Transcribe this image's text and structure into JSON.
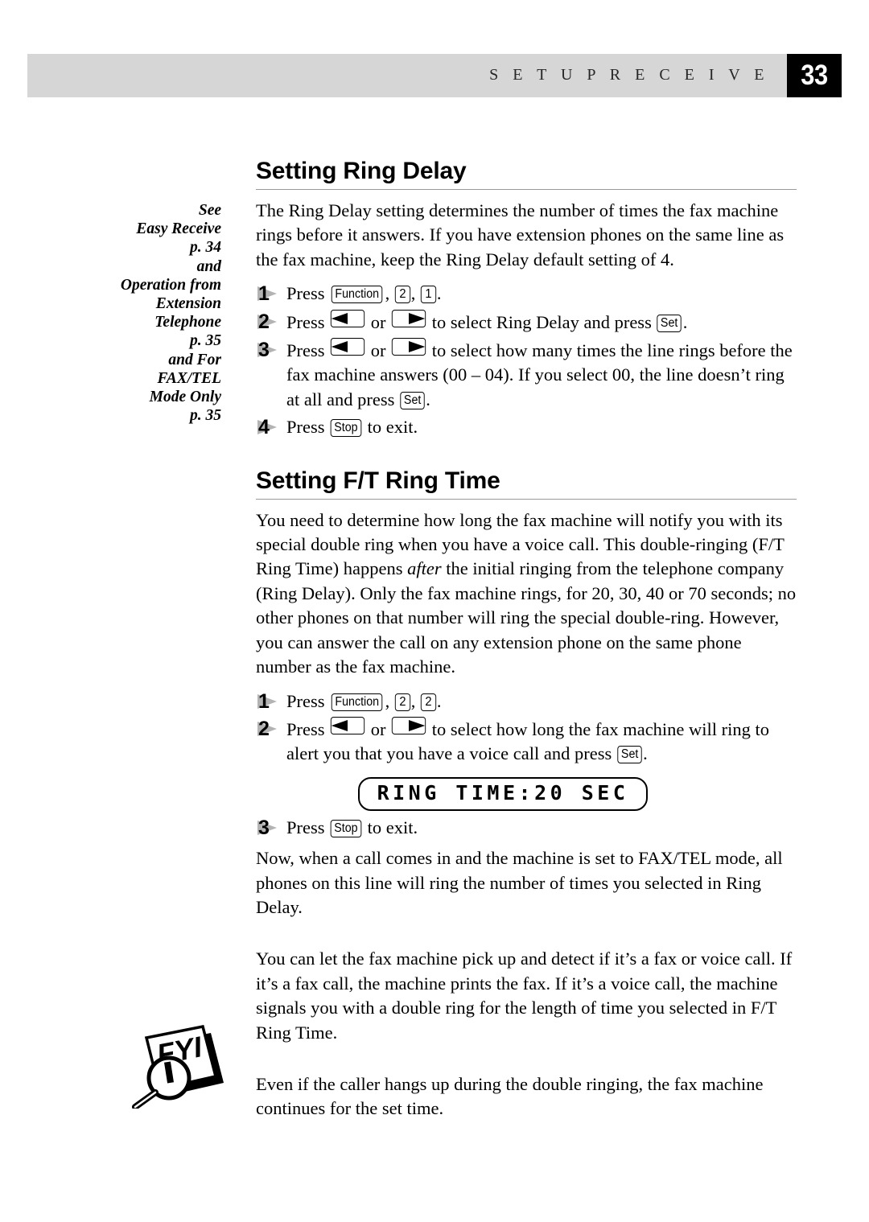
{
  "header": {
    "running_title": "S E T U P   R E C E I V E",
    "page_number": "33",
    "bar_color": "#d6d6d6",
    "page_number_bg": "#000000"
  },
  "margin_note": {
    "lines": [
      "See",
      "Easy Receive",
      "p. 34",
      "and",
      "Operation from",
      "Extension",
      "Telephone",
      "p. 35",
      "and For",
      "FAX/TEL",
      "Mode Only",
      "p. 35"
    ]
  },
  "sections": [
    {
      "heading": "Setting Ring Delay",
      "intro": "The Ring Delay setting determines the number of times the fax machine rings before it answers. If you have extension phones on the same line as the fax machine, keep the Ring Delay default setting of 4.",
      "steps": [
        {
          "num": "1",
          "pre": "Press ",
          "keys_line": "Function, 2, 1."
        },
        {
          "num": "2",
          "pre": "Press ",
          "mid": " or ",
          "post": " to select Ring Delay and press ",
          "tail": "."
        },
        {
          "num": "3",
          "pre": "Press ",
          "mid": " or ",
          "post": " to select how many times the line rings before the fax machine answers (00 – 04). If you select 00, the line doesn’t ring at all and press ",
          "tail": "."
        },
        {
          "num": "4",
          "pre": "Press ",
          "post": " to exit."
        }
      ]
    },
    {
      "heading": "Setting F/T Ring Time",
      "intro_a": "You need to determine how long the fax machine will notify you with its special double ring when you have a voice call. This double-ringing (F/T Ring Time) happens ",
      "intro_italic": "after",
      "intro_b": " the initial ringing from the telephone company (Ring Delay). Only the fax machine rings, for 20, 30, 40 or 70 seconds; no other phones on that number will ring the special double-ring. However, you can answer the call on any extension phone on the same phone number as the fax machine.",
      "steps": [
        {
          "num": "1",
          "pre": "Press ",
          "keys_line": "Function, 2, 2."
        },
        {
          "num": "2",
          "pre": "Press ",
          "mid": " or ",
          "post": " to select how long the fax machine will ring to alert you that you have a voice call and press ",
          "tail": "."
        },
        {
          "num": "3",
          "pre": "Press ",
          "post": " to exit."
        }
      ],
      "lcd_display": "RING TIME:20 SEC",
      "after_text": "Now, when a call comes in and the machine is set to FAX/TEL mode, all phones on this line will ring the number of times you selected in Ring Delay.",
      "detect_text": "You can let the fax machine pick up and detect if it’s a fax or voice call. If it’s a fax call, the machine prints the fax. If it’s a voice call, the machine signals you with a double ring for the length of time you selected in F/T Ring Time.",
      "fyi_text": "Even if the caller hangs up during the double ringing, the fax machine continues for the set time."
    }
  ],
  "keys": {
    "function": "Function",
    "set": "Set",
    "stop": "Stop",
    "digit_1": "1",
    "digit_2": "2",
    "comma": ", ",
    "period": ".",
    "left_arrow": "left-arrow",
    "right_arrow": "right-arrow"
  },
  "icons": {
    "fyi": "fyi-magnifier-icon"
  }
}
